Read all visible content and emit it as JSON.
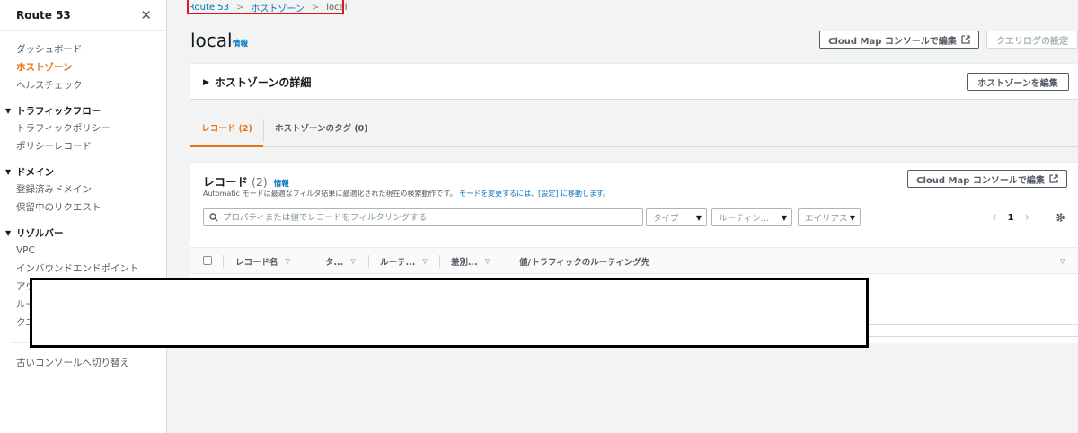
{
  "sidebar": {
    "title": "Route 53",
    "items_top": [
      {
        "label": "ダッシュボード",
        "active": false
      },
      {
        "label": "ホストゾーン",
        "active": true
      },
      {
        "label": "ヘルスチェック",
        "active": false
      }
    ],
    "sections": [
      {
        "label": "トラフィックフロー",
        "items": [
          "トラフィックポリシー",
          "ポリシーレコード"
        ]
      },
      {
        "label": "ドメイン",
        "items": [
          "登録済みドメイン",
          "保留中のリクエスト"
        ]
      },
      {
        "label": "リゾルバー",
        "items": [
          "VPC",
          "インバウンドエンドポイント",
          "アウトバウンドエンドポイント",
          "ルール",
          "クエリのログ記録"
        ]
      }
    ],
    "footer_link": "古いコンソールへ切り替え"
  },
  "breadcrumb": [
    "Route 53",
    "ホストゾーン",
    "local"
  ],
  "header": {
    "title": "local",
    "info": "情報",
    "cloud_map_button": "Cloud Map コンソールで編集",
    "query_log_button": "クエリログの設定"
  },
  "details": {
    "title": "ホストゾーンの詳細",
    "edit_button": "ホストゾーンを編集"
  },
  "tabs": [
    {
      "label": "レコード (2)",
      "active": true
    },
    {
      "label": "ホストゾーンのタグ (0)",
      "active": false
    }
  ],
  "records": {
    "title": "レコード",
    "count": "(2)",
    "info": "情報",
    "desc_pre": "Automatic モードは最適なフィルタ結果に最適化された現在の検索動作です。",
    "desc_link": "モードを変更するには、[設定] に移動します。",
    "cloud_map_button": "Cloud Map コンソールで編集",
    "search_placeholder": "プロパティまたは値でレコードをフィルタリングする",
    "filters": [
      "タイプ",
      "ルーティン...",
      "エイリアス"
    ],
    "page": "1",
    "columns": [
      "レコード名",
      "タ...",
      "ルーテ...",
      "差別...",
      "値/トラフィックのルーティング先"
    ]
  },
  "colors": {
    "accent": "#ec7211",
    "link": "#0073bb",
    "highlight_box": "#e5131b"
  }
}
